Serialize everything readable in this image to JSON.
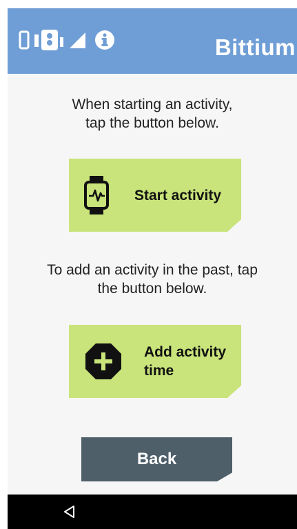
{
  "statusbar": {
    "brand": "Bittium",
    "icons": [
      "phone-icon",
      "sensor-icon",
      "signal-icon",
      "info-icon"
    ]
  },
  "main": {
    "start_instruction": {
      "line1": "When starting an activity,",
      "line2": "tap the button below."
    },
    "start_button": {
      "label": "Start activity",
      "icon": "heart-watch-icon"
    },
    "past_instruction": {
      "line1": "To add an activity in the past, tap",
      "line2": "the button below."
    },
    "add_button": {
      "label_line1": "Add activity",
      "label_line2": "time",
      "icon": "add-icon"
    },
    "back_button": {
      "label": "Back"
    }
  },
  "navbar": {
    "back_icon": "nav-back-icon"
  },
  "colors": {
    "header": "#6f9ed6",
    "accent_button": "#c9e47a",
    "back_button": "#4e5f6a",
    "background": "#f6f6f6"
  }
}
